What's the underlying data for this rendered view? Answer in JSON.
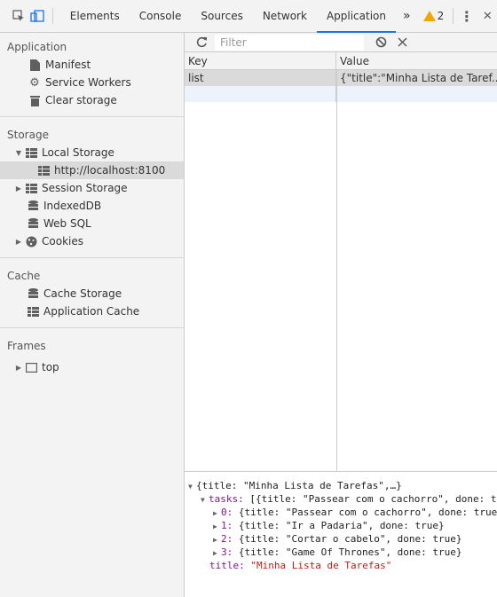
{
  "toolbar": {
    "tabs": [
      "Elements",
      "Console",
      "Sources",
      "Network",
      "Application"
    ],
    "active_tab": "Application",
    "more": "»",
    "warning_count": "2",
    "menu": "⋮",
    "close": "✕"
  },
  "sidebar": {
    "application": {
      "title": "Application",
      "items": [
        "Manifest",
        "Service Workers",
        "Clear storage"
      ]
    },
    "storage": {
      "title": "Storage",
      "local_storage": "Local Storage",
      "local_origin": "http://localhost:8100",
      "session_storage": "Session Storage",
      "indexeddb": "IndexedDB",
      "websql": "Web SQL",
      "cookies": "Cookies"
    },
    "cache": {
      "title": "Cache",
      "items": [
        "Cache Storage",
        "Application Cache"
      ]
    },
    "frames": {
      "title": "Frames",
      "top": "top"
    }
  },
  "main": {
    "filter": {
      "placeholder": "Filter"
    },
    "columns": {
      "key": "Key",
      "value": "Value"
    },
    "rows": [
      {
        "key": "list",
        "value": "{\"title\":\"Minha Lista de Taref..."
      }
    ],
    "preview": {
      "root": "{title: \"Minha Lista de Tarefas\",…}",
      "tasks_key": "tasks:",
      "tasks_summary": " [{title: \"Passear com o cachorro\", done: t",
      "items": [
        {
          "idx": "0:",
          "text": " {title: \"Passear com o cachorro\", done: true"
        },
        {
          "idx": "1:",
          "text": " {title: \"Ir a Padaria\", done: true}"
        },
        {
          "idx": "2:",
          "text": " {title: \"Cortar o cabelo\", done: true}"
        },
        {
          "idx": "3:",
          "text": " {title: \"Game Of Thrones\", done: true}"
        }
      ],
      "title_key": "title:",
      "title_value": " \"Minha Lista de Tarefas\""
    }
  },
  "colors": {
    "accent": "#1a73e8",
    "warning": "#f2a600",
    "selection": "#dadada"
  }
}
